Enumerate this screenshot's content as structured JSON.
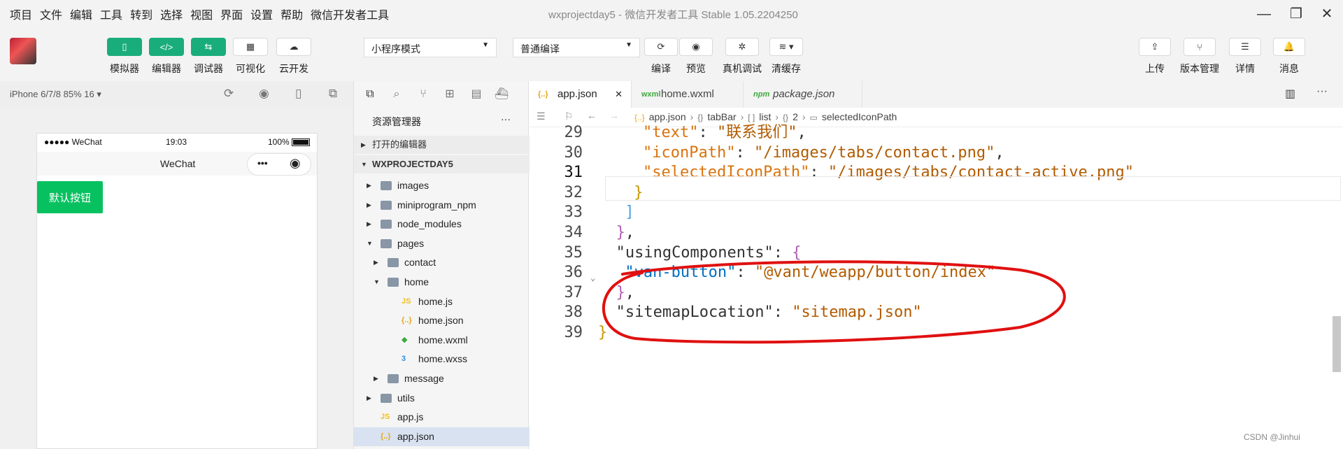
{
  "menubar": {
    "items": [
      "项目",
      "文件",
      "编辑",
      "工具",
      "转到",
      "选择",
      "视图",
      "界面",
      "设置",
      "帮助",
      "微信开发者工具"
    ],
    "title": "wxprojectday5 - 微信开发者工具 Stable 1.05.2204250"
  },
  "toolbar": {
    "left_buttons": [
      {
        "label": "模拟器",
        "icon": "phone-icon"
      },
      {
        "label": "编辑器",
        "icon": "code-icon"
      },
      {
        "label": "调试器",
        "icon": "debug-icon"
      },
      {
        "label": "可视化",
        "icon": "layout-icon"
      },
      {
        "label": "云开发",
        "icon": "cloud-icon"
      }
    ],
    "mode_select": "小程序模式",
    "compile_select": "普通编译",
    "center_buttons": [
      {
        "label": "编译",
        "icon": "refresh-icon"
      },
      {
        "label": "预览",
        "icon": "eye-icon"
      },
      {
        "label": "真机调试",
        "icon": "bug-icon"
      },
      {
        "label": "清缓存",
        "icon": "layers-icon"
      }
    ],
    "right_buttons": [
      {
        "label": "上传",
        "icon": "upload-icon"
      },
      {
        "label": "版本管理",
        "icon": "branch-icon"
      },
      {
        "label": "详情",
        "icon": "menu-icon"
      },
      {
        "label": "消息",
        "icon": "bell-icon"
      }
    ]
  },
  "simulator": {
    "device": "iPhone 6/7/8 85% 16 ▾",
    "status_signal": "●●●●● WeChat",
    "status_time": "19:03",
    "status_battery": "100%",
    "nav_title": "WeChat",
    "default_button": "默认按钮"
  },
  "explorer": {
    "title": "资源管理器",
    "more": "···",
    "open_editors": "打开的编辑器",
    "project": "WXPROJECTDAY5",
    "tree": [
      {
        "label": "images",
        "depth": 1,
        "type": "folder",
        "caret": "▶"
      },
      {
        "label": "miniprogram_npm",
        "depth": 1,
        "type": "folder",
        "caret": "▶"
      },
      {
        "label": "node_modules",
        "depth": 1,
        "type": "folder",
        "caret": "▶"
      },
      {
        "label": "pages",
        "depth": 1,
        "type": "folder",
        "caret": "▼"
      },
      {
        "label": "contact",
        "depth": 2,
        "type": "folder",
        "caret": "▶"
      },
      {
        "label": "home",
        "depth": 2,
        "type": "folder",
        "caret": "▼"
      },
      {
        "label": "home.js",
        "depth": 3,
        "type": "js",
        "caret": ""
      },
      {
        "label": "home.json",
        "depth": 3,
        "type": "json",
        "caret": ""
      },
      {
        "label": "home.wxml",
        "depth": 3,
        "type": "wxml",
        "caret": ""
      },
      {
        "label": "home.wxss",
        "depth": 3,
        "type": "wxss",
        "caret": ""
      },
      {
        "label": "message",
        "depth": 2,
        "type": "folder",
        "caret": "▶"
      },
      {
        "label": "utils",
        "depth": 1,
        "type": "folder",
        "caret": "▶"
      },
      {
        "label": "app.js",
        "depth": 1,
        "type": "js",
        "caret": ""
      },
      {
        "label": "app.json",
        "depth": 1,
        "type": "json",
        "caret": ""
      }
    ]
  },
  "editor": {
    "tabs": [
      {
        "label": "app.json",
        "icon": "{..}"
      },
      {
        "label": "home.wxml",
        "icon": "wxml"
      },
      {
        "label": "package.json",
        "icon": "npm"
      }
    ],
    "breadcrumb": [
      "app.json",
      "tabBar",
      "list",
      "2",
      "selectedIconPath"
    ],
    "breadcrumb_icons": [
      "{..}",
      "{}",
      "[ ]",
      "{}",
      "▭"
    ],
    "lines": [
      {
        "n": "29",
        "text": "\"text\": \"联系我们\","
      },
      {
        "n": "30",
        "text": "\"iconPath\": \"/images/tabs/contact.png\","
      },
      {
        "n": "31",
        "text": "\"selectedIconPath\": \"/images/tabs/contact-active.png\""
      },
      {
        "n": "32",
        "text": "}"
      },
      {
        "n": "33",
        "text": "]"
      },
      {
        "n": "34",
        "text": "},"
      },
      {
        "n": "35",
        "text": "\"usingComponents\": {"
      },
      {
        "n": "36",
        "text": "\"van-button\": \"@vant/weapp/button/index\""
      },
      {
        "n": "37",
        "text": "},"
      },
      {
        "n": "38",
        "text": "\"sitemapLocation\": \"sitemap.json\""
      },
      {
        "n": "39",
        "text": "}"
      }
    ]
  },
  "watermark": "CSDN @Jinhui",
  "colors": {
    "accent_green": "#1aad7c",
    "wechat_green": "#07c160",
    "annotation_red": "#e01010"
  }
}
